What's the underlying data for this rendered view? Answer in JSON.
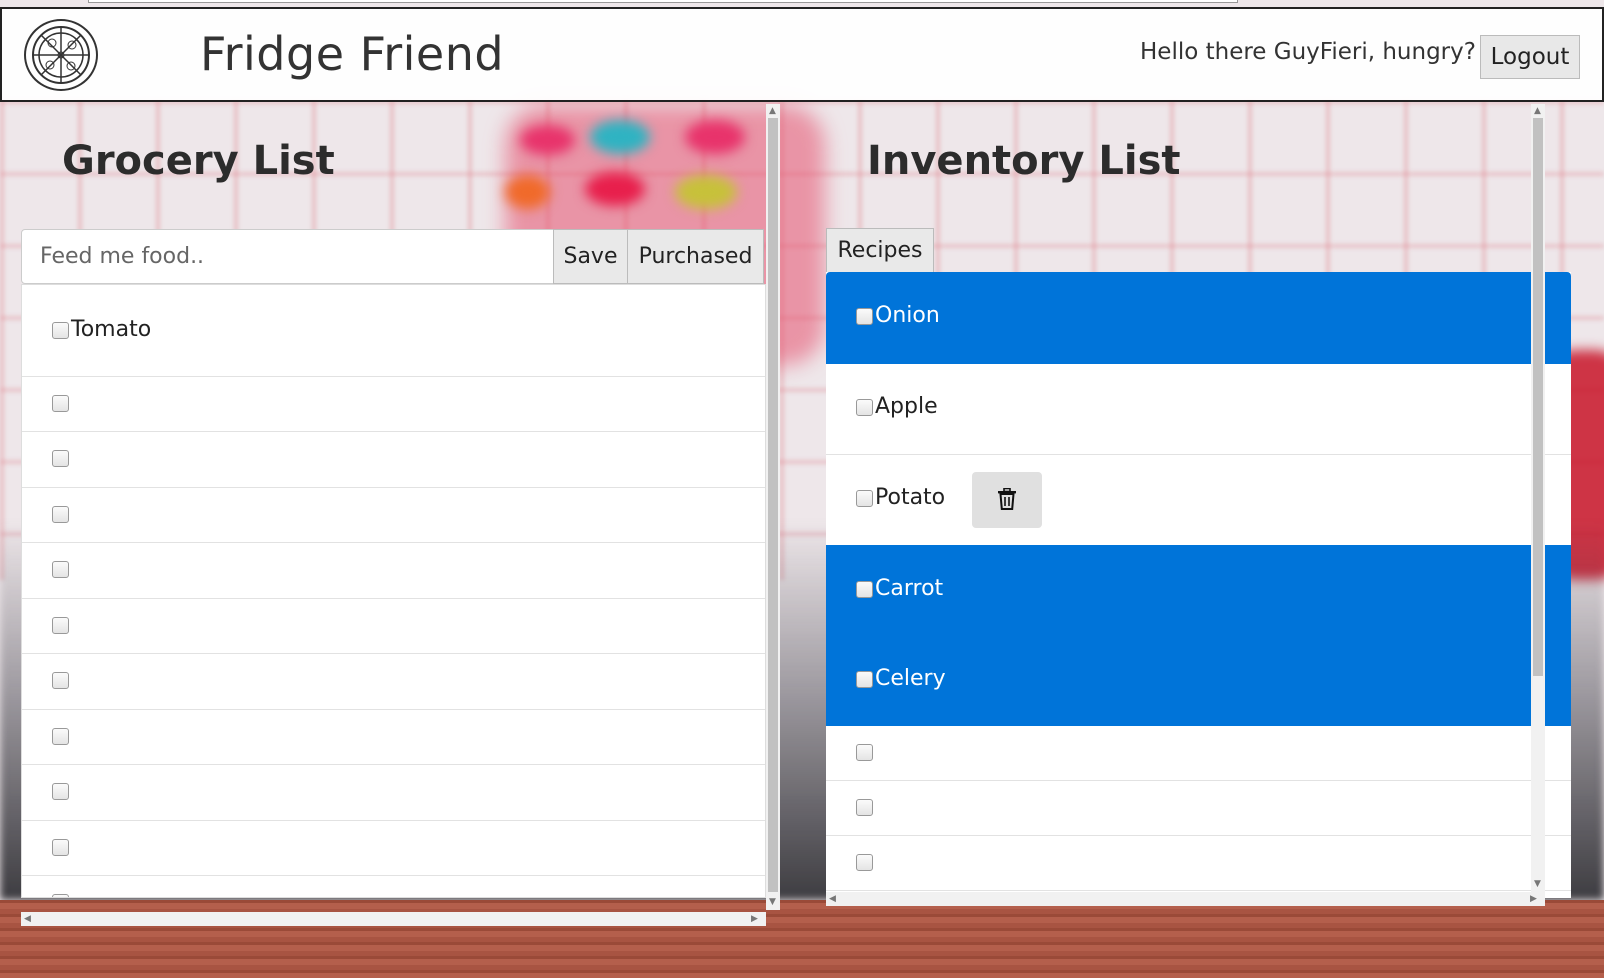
{
  "header": {
    "title": "Fridge Friend",
    "greeting": "Hello there GuyFieri, hungry?",
    "logout_label": "Logout",
    "logo_icon": "pizza-logo-icon"
  },
  "grocery": {
    "title": "Grocery List",
    "input_placeholder": "Feed me food..",
    "input_value": "",
    "save_label": "Save",
    "purchased_label": "Purchased",
    "items": [
      {
        "label": "Tomato",
        "checked": false
      },
      {
        "label": "",
        "checked": false
      },
      {
        "label": "",
        "checked": false
      },
      {
        "label": "",
        "checked": false
      },
      {
        "label": "",
        "checked": false
      },
      {
        "label": "",
        "checked": false
      },
      {
        "label": "",
        "checked": false
      },
      {
        "label": "",
        "checked": false
      },
      {
        "label": "",
        "checked": false
      },
      {
        "label": "",
        "checked": false
      },
      {
        "label": "",
        "checked": false
      }
    ]
  },
  "inventory": {
    "title": "Inventory List",
    "recipes_label": "Recipes",
    "items": [
      {
        "label": "Onion",
        "selected": true,
        "checked": false
      },
      {
        "label": "Apple",
        "selected": false,
        "checked": false
      },
      {
        "label": "Potato",
        "selected": false,
        "checked": false,
        "show_delete": true
      },
      {
        "label": "Carrot",
        "selected": true,
        "checked": false
      },
      {
        "label": "Celery",
        "selected": true,
        "checked": false
      },
      {
        "label": "",
        "selected": false,
        "checked": false
      },
      {
        "label": "",
        "selected": false,
        "checked": false
      },
      {
        "label": "",
        "selected": false,
        "checked": false
      }
    ],
    "delete_icon": "trash-icon"
  },
  "colors": {
    "selected_row": "#0074d9",
    "header_bg": "#ffffff",
    "title_text": "#2c2c2c"
  }
}
